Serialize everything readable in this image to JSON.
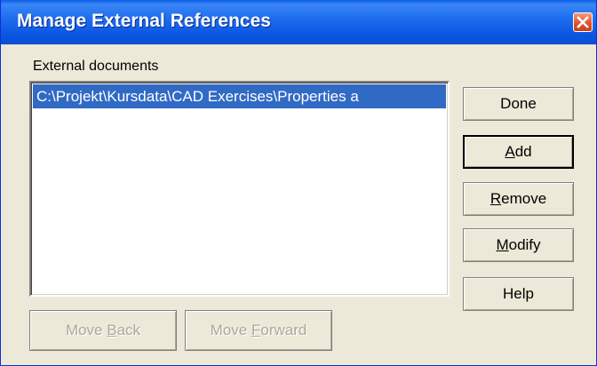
{
  "window": {
    "title": "Manage External References"
  },
  "list": {
    "label": "External documents",
    "items": [
      "C:\\Projekt\\Kursdata\\CAD Exercises\\Properties a"
    ]
  },
  "buttons": {
    "done": "Done",
    "add": "Add",
    "remove": "Remove",
    "modify": "Modify",
    "help": "Help",
    "move_back": "Move Back",
    "move_forward": "Move Forward"
  },
  "icons": {
    "close": "close-icon"
  }
}
